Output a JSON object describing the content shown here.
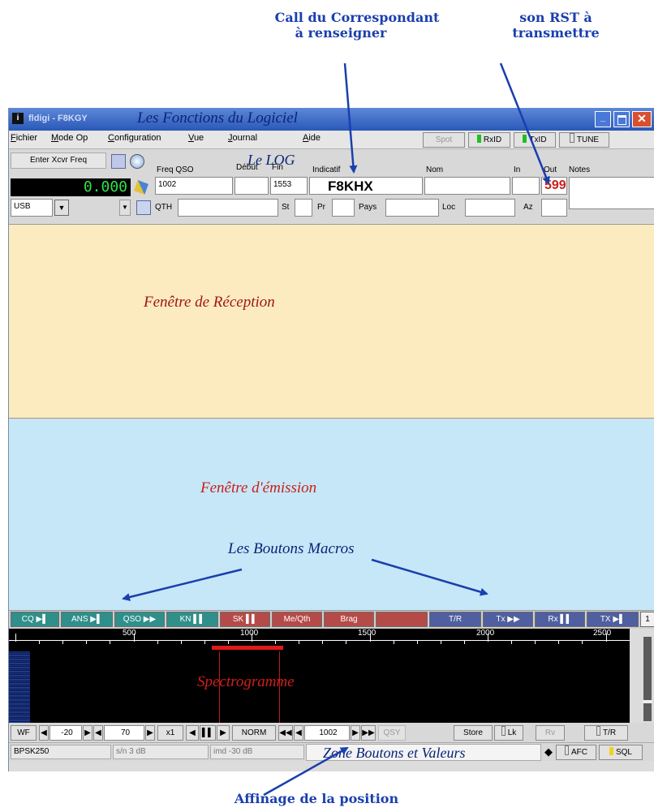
{
  "annotations": {
    "call_line1": "Call du Correspondant",
    "call_line2": "à renseigner",
    "rst_line1": "son RST à",
    "rst_line2": "transmettre",
    "title_overlay": "Les Fonctions du Logiciel",
    "log": "Le  LOG",
    "receive": "Fenêtre de Réception",
    "transmit": "Fenêtre d'émission",
    "macros": "Les Boutons Macros",
    "spectro": "Spectrogramme",
    "zone": "Zone Boutons et Valeurs",
    "fine_tune": "Affinage de la position"
  },
  "window": {
    "title": "fldigi - F8KGY"
  },
  "menu": [
    "Fichier",
    "Mode Op",
    "Configuration",
    "Vue",
    "Journal",
    "Aide"
  ],
  "toolbar": {
    "spot": "Spot",
    "rxid": "RxID",
    "txid": "TxID",
    "tune": "TUNE"
  },
  "log": {
    "enter_freq": "Enter Xcvr Freq",
    "freq_display": "0.000",
    "labels": {
      "freq_qso": "Freq QSO",
      "debut": "Début",
      "fin": "Fin",
      "indicatif": "Indicatif",
      "nom": "Nom",
      "in": "In",
      "out": "Out",
      "notes": "Notes",
      "qth": "QTH",
      "st": "St",
      "pr": "Pr",
      "pays": "Pays",
      "loc": "Loc",
      "az": "Az"
    },
    "values": {
      "freq_qso": "1002",
      "fin": "1553",
      "indicatif": "F8KHX",
      "out": "599"
    },
    "mode": "USB"
  },
  "macros": {
    "buttons": [
      "CQ",
      "ANS",
      "QSO",
      "KN",
      "SK",
      "Me/Qth",
      "Brag",
      "",
      "T/R",
      "Tx",
      "Rx",
      "TX"
    ],
    "end_label": "1"
  },
  "scale": [
    "500",
    "1000",
    "1500",
    "2000",
    "2500"
  ],
  "controls": {
    "wf": "WF",
    "ref": "-20",
    "range": "70",
    "zoom": "x1",
    "speed": "NORM",
    "carrier": "1002",
    "qsy": "QSY",
    "store": "Store",
    "lk": "Lk",
    "rv": "Rv",
    "tr": "T/R"
  },
  "status": {
    "mode": "BPSK250",
    "sn": "s/n  3 dB",
    "imd": "imd -30 dB",
    "afc": "AFC",
    "sql": "SQL"
  },
  "colors": {
    "rx_bg": "#fcebbf",
    "tx_bg": "#c6e7f8",
    "accent_red": "#c8201a",
    "annotation_blue": "#1a3fae"
  }
}
